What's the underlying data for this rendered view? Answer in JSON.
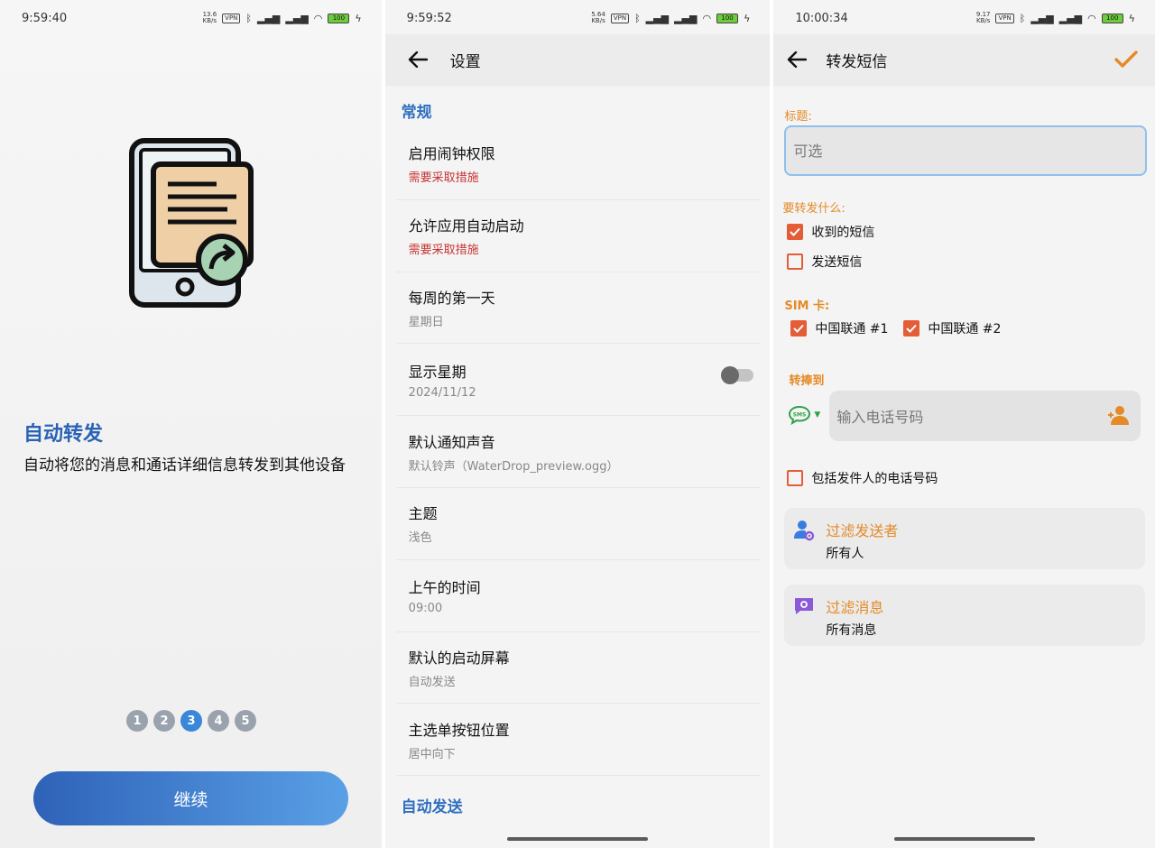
{
  "screen1": {
    "status": {
      "time": "9:59:40",
      "speed_top": "13.6",
      "speed_unit": "KB/s",
      "vpn": "VPN",
      "battery": "100"
    },
    "title": "自动转发",
    "description": "自动将您的消息和通话详细信息转发到其他设备",
    "steps": [
      "1",
      "2",
      "3",
      "4",
      "5"
    ],
    "active_step": 3,
    "continue_label": "继续"
  },
  "screen2": {
    "status": {
      "time": "9:59:52",
      "speed_top": "5.64",
      "speed_unit": "KB/s",
      "vpn": "VPN",
      "battery": "100"
    },
    "title": "设置",
    "section_general": "常规",
    "items": [
      {
        "title": "启用闹钟权限",
        "subtitle": "需要采取措施",
        "warn": true
      },
      {
        "title": "允许应用自动启动",
        "subtitle": "需要采取措施",
        "warn": true
      },
      {
        "title": "每周的第一天",
        "subtitle": "星期日",
        "warn": false
      },
      {
        "title": "显示星期",
        "subtitle": "2024/11/12",
        "warn": false,
        "toggle_on": false
      },
      {
        "title": "默认通知声音",
        "subtitle": "默认铃声（WaterDrop_preview.ogg）",
        "warn": false
      },
      {
        "title": "主题",
        "subtitle": "浅色",
        "warn": false
      },
      {
        "title": "上午的时间",
        "subtitle": "09:00",
        "warn": false
      },
      {
        "title": "默认的启动屏幕",
        "subtitle": "自动发送",
        "warn": false
      },
      {
        "title": "主选单按钮位置",
        "subtitle": "居中向下",
        "warn": false
      }
    ],
    "section_autosend": "自动发送"
  },
  "screen3": {
    "status": {
      "time": "10:00:34",
      "speed_top": "9.17",
      "speed_unit": "KB/s",
      "vpn": "VPN",
      "battery": "100"
    },
    "title": "转发短信",
    "title_label": "标题:",
    "title_placeholder": "可选",
    "forward_what_label": "要转发什么:",
    "received_sms": {
      "label": "收到的短信",
      "checked": true
    },
    "sent_sms": {
      "label": "发送短信",
      "checked": false
    },
    "sim_label": "SIM 卡:",
    "sim1": {
      "label": "中国联通 #1",
      "checked": true
    },
    "sim2": {
      "label": "中国联通 #2",
      "checked": true
    },
    "forward_to_label": "转捧到",
    "sms_badge": "SMS",
    "phone_placeholder": "输入电话号码",
    "include_sender": {
      "label": "包括发件人的电话号码",
      "checked": false
    },
    "filter_sender": {
      "title": "过滤发送者",
      "value": "所有人"
    },
    "filter_message": {
      "title": "过滤消息",
      "value": "所有消息"
    }
  },
  "colors": {
    "accent_blue": "#2e6fc0",
    "accent_orange": "#e58a27",
    "checkbox": "#e45d36",
    "warning": "#c83434"
  }
}
